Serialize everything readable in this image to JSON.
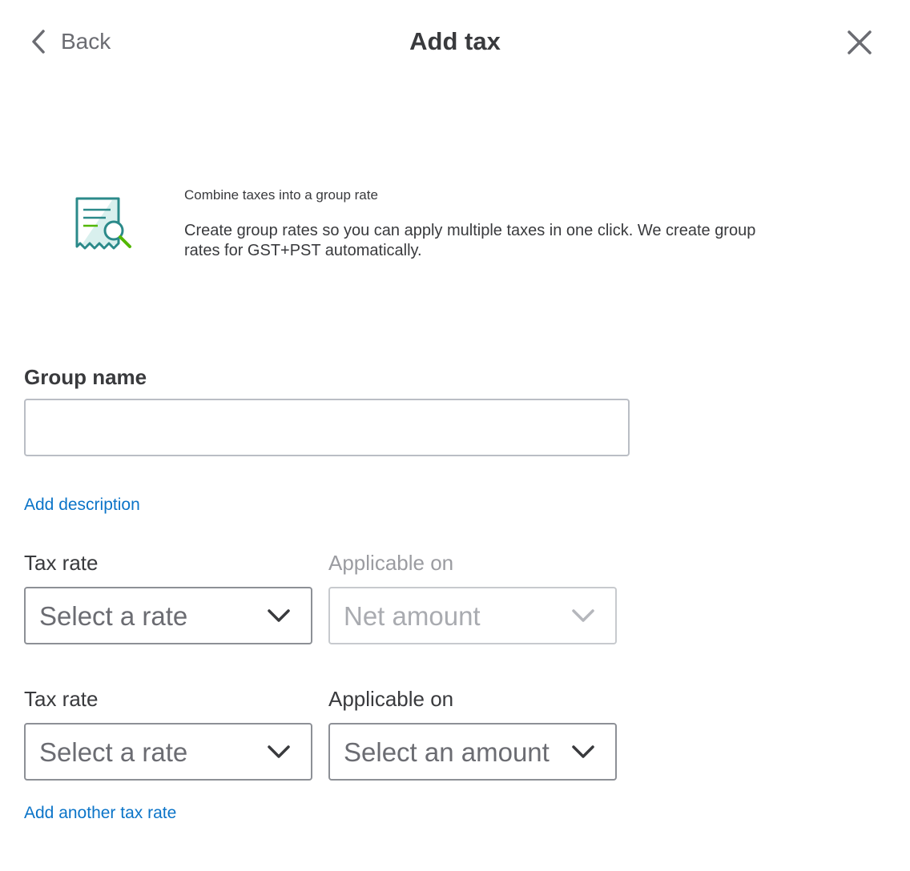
{
  "header": {
    "back_label": "Back",
    "title": "Add tax"
  },
  "promo": {
    "icon": "receipt-search-icon",
    "title": "Combine taxes into a group rate",
    "description": "Create group rates so you can apply multiple taxes in one click. We create group rates for GST+PST automatically."
  },
  "group_name": {
    "label": "Group name",
    "value": "",
    "placeholder": ""
  },
  "add_description_label": "Add description",
  "tax_rows": [
    {
      "rate_label": "Tax rate",
      "rate_value": "Select a rate",
      "applicable_label": "Applicable on",
      "applicable_value": "Net amount",
      "applicable_disabled": true
    },
    {
      "rate_label": "Tax rate",
      "rate_value": "Select a rate",
      "applicable_label": "Applicable on",
      "applicable_value": "Select an amount",
      "applicable_disabled": false
    }
  ],
  "add_another_label": "Add another tax rate",
  "colors": {
    "link": "#0b74c8",
    "text": "#393a3d",
    "icon_teal": "#2b8a8a",
    "icon_green": "#53b700"
  }
}
